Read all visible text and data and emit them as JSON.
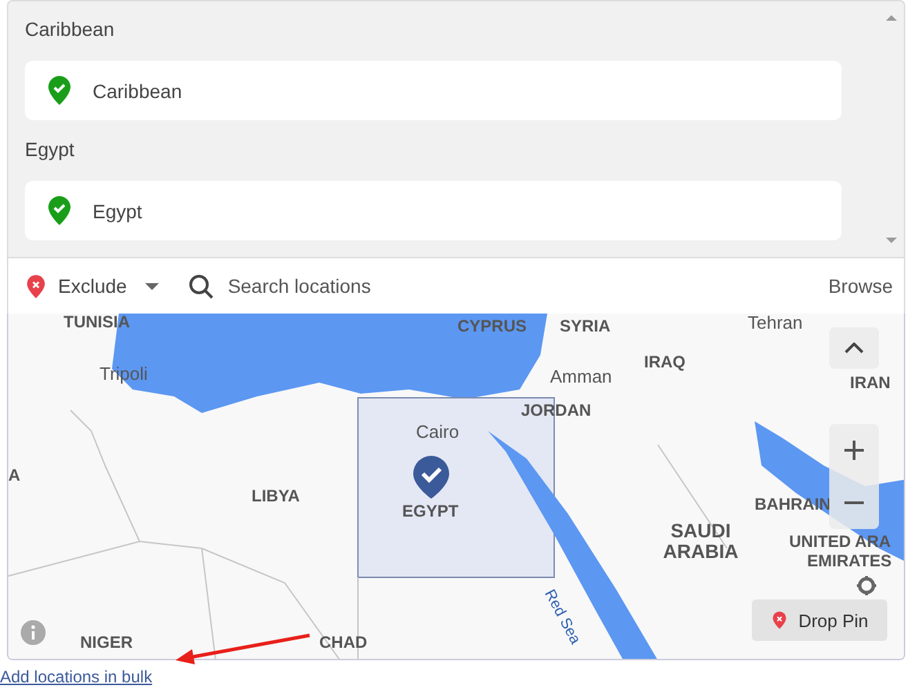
{
  "sections": [
    {
      "heading": "Caribbean",
      "location": {
        "name": "Caribbean",
        "included": true
      }
    },
    {
      "heading": "Egypt",
      "location": {
        "name": "Egypt",
        "included": true
      }
    }
  ],
  "toolbar": {
    "mode": {
      "label": "Exclude",
      "kind": "exclude"
    },
    "search": {
      "placeholder": "Search locations"
    },
    "browse": "Browse"
  },
  "map": {
    "labels": [
      {
        "text": "TUNISIA",
        "kind": "country"
      },
      {
        "text": "CYPRUS",
        "kind": "country"
      },
      {
        "text": "SYRIA",
        "kind": "country"
      },
      {
        "text": "Tehran",
        "kind": "city"
      },
      {
        "text": "Tripoli",
        "kind": "city"
      },
      {
        "text": "Amman",
        "kind": "city"
      },
      {
        "text": "IRAQ",
        "kind": "country"
      },
      {
        "text": "IRAN",
        "kind": "country"
      },
      {
        "text": "JORDAN",
        "kind": "country"
      },
      {
        "text": "Cairo",
        "kind": "city"
      },
      {
        "text": "LIBYA",
        "kind": "country"
      },
      {
        "text": "EGYPT",
        "kind": "country"
      },
      {
        "text": "BAHRAIN",
        "kind": "country"
      },
      {
        "text": "SAUDI ARABIA",
        "kind": "country"
      },
      {
        "text": "UNITED ARA",
        "kind": "country"
      },
      {
        "text": "EMIRATES",
        "kind": "country"
      },
      {
        "text": "Red Sea",
        "kind": "water"
      },
      {
        "text": "NIGER",
        "kind": "country"
      },
      {
        "text": "CHAD",
        "kind": "country"
      },
      {
        "text": "A",
        "kind": "country"
      }
    ],
    "drop_pin": "Drop Pin"
  },
  "bulk_link": "Add locations in bulk"
}
